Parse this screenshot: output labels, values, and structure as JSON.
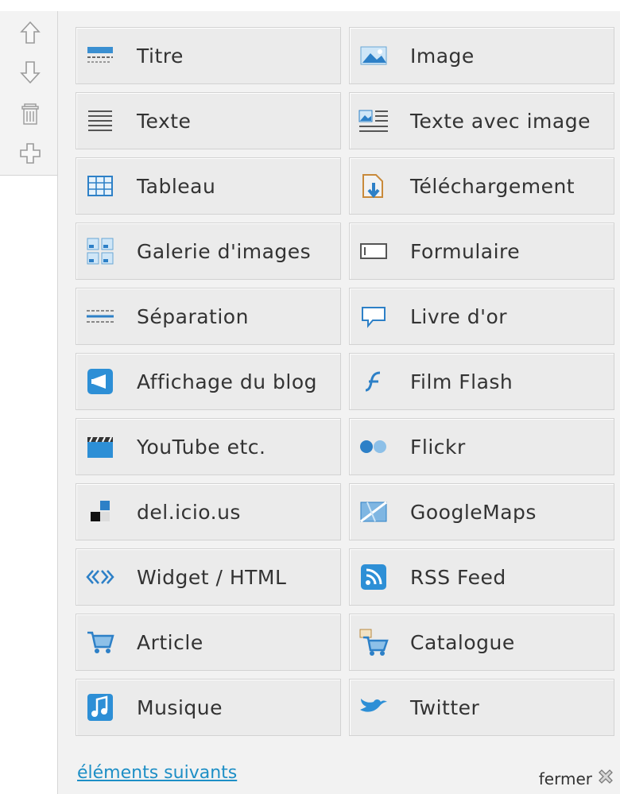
{
  "toolbar": {
    "buttons": [
      {
        "icon": "arrow-up-icon"
      },
      {
        "icon": "arrow-down-icon"
      },
      {
        "icon": "trash-icon"
      },
      {
        "icon": "plus-icon"
      }
    ]
  },
  "elements": [
    {
      "label": "Titre",
      "icon": "title-icon"
    },
    {
      "label": "Image",
      "icon": "image-icon"
    },
    {
      "label": "Texte",
      "icon": "text-icon"
    },
    {
      "label": "Texte avec image",
      "icon": "text-with-image-icon"
    },
    {
      "label": "Tableau",
      "icon": "table-icon"
    },
    {
      "label": "Téléchargement",
      "icon": "download-icon"
    },
    {
      "label": "Galerie d'images",
      "icon": "gallery-icon"
    },
    {
      "label": "Formulaire",
      "icon": "form-icon"
    },
    {
      "label": "Séparation",
      "icon": "separator-icon"
    },
    {
      "label": "Livre d'or",
      "icon": "guestbook-icon"
    },
    {
      "label": "Affichage du blog",
      "icon": "blog-icon"
    },
    {
      "label": "Film Flash",
      "icon": "flash-icon"
    },
    {
      "label": "YouTube etc.",
      "icon": "video-icon"
    },
    {
      "label": "Flickr",
      "icon": "flickr-icon"
    },
    {
      "label": "del.icio.us",
      "icon": "delicious-icon"
    },
    {
      "label": "GoogleMaps",
      "icon": "map-icon"
    },
    {
      "label": "Widget / HTML",
      "icon": "code-icon"
    },
    {
      "label": "RSS Feed",
      "icon": "rss-icon"
    },
    {
      "label": "Article",
      "icon": "cart-icon"
    },
    {
      "label": "Catalogue",
      "icon": "catalogue-icon"
    },
    {
      "label": "Musique",
      "icon": "music-icon"
    },
    {
      "label": "Twitter",
      "icon": "twitter-icon"
    }
  ],
  "footer": {
    "next_label": "éléments suivants",
    "close_label": "fermer"
  },
  "colors": {
    "accent": "#1e8fc6",
    "tile_bg": "#ebebeb",
    "panel_bg": "#f2f2f2"
  }
}
